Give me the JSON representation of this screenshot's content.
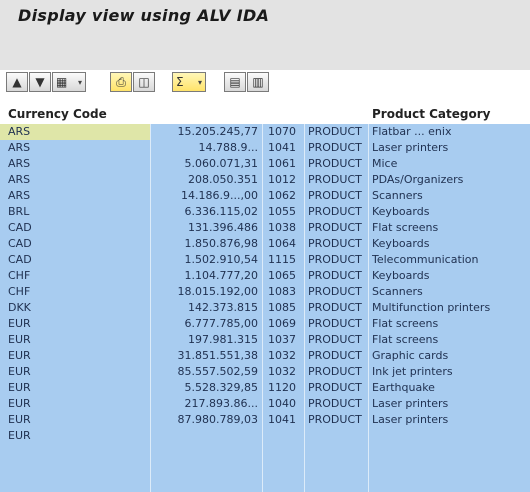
{
  "window": {
    "title": "Display view using ALV IDA"
  },
  "toolbar": {
    "groups": [
      {
        "buttons": [
          "sort-ascending-icon",
          "sort-descending-icon",
          "filter-icon"
        ]
      },
      {
        "buttons": [
          "print-icon",
          "export-icon"
        ]
      },
      {
        "buttons": [
          "sum-icon"
        ]
      },
      {
        "buttons": [
          "layout-icon",
          "details-icon"
        ]
      }
    ]
  },
  "columns": {
    "currency": "Currency Code",
    "category": "Product Category"
  },
  "rows": [
    {
      "currency": "ARS",
      "amount": "15.205.245,77",
      "num": "1070",
      "prod": "PRODUCT",
      "category": "Flatbar ... enix"
    },
    {
      "currency": "ARS",
      "amount": "14.788.9...",
      "num": "1041",
      "prod": "PRODUCT",
      "category": "Laser printers"
    },
    {
      "currency": "ARS",
      "amount": "5.060.071,31",
      "num": "1061",
      "prod": "PRODUCT",
      "category": "Mice"
    },
    {
      "currency": "ARS",
      "amount": "208.050.351",
      "num": "1012",
      "prod": "PRODUCT",
      "category": "PDAs/Organizers"
    },
    {
      "currency": "ARS",
      "amount": "14.186.9...,00",
      "num": "1062",
      "prod": "PRODUCT",
      "category": "Scanners"
    },
    {
      "currency": "BRL",
      "amount": "6.336.115,02",
      "num": "1055",
      "prod": "PRODUCT",
      "category": "Keyboards"
    },
    {
      "currency": "CAD",
      "amount": "131.396.486",
      "num": "1038",
      "prod": "PRODUCT",
      "category": "Flat screens"
    },
    {
      "currency": "CAD",
      "amount": "1.850.876,98",
      "num": "1064",
      "prod": "PRODUCT",
      "category": "Keyboards"
    },
    {
      "currency": "CAD",
      "amount": "1.502.910,54",
      "num": "1115",
      "prod": "PRODUCT",
      "category": "Telecommunication"
    },
    {
      "currency": "CHF",
      "amount": "1.104.777,20",
      "num": "1065",
      "prod": "PRODUCT",
      "category": "Keyboards"
    },
    {
      "currency": "CHF",
      "amount": "18.015.192,00",
      "num": "1083",
      "prod": "PRODUCT",
      "category": "Scanners"
    },
    {
      "currency": "DKK",
      "amount": "142.373.815",
      "num": "1085",
      "prod": "PRODUCT",
      "category": "Multifunction printers"
    },
    {
      "currency": "EUR",
      "amount": "6.777.785,00",
      "num": "1069",
      "prod": "PRODUCT",
      "category": "Flat screens"
    },
    {
      "currency": "EUR",
      "amount": "197.981.315",
      "num": "1037",
      "prod": "PRODUCT",
      "category": "Flat screens"
    },
    {
      "currency": "EUR",
      "amount": "31.851.551,38",
      "num": "1032",
      "prod": "PRODUCT",
      "category": "Graphic cards"
    },
    {
      "currency": "EUR",
      "amount": "85.557.502,59",
      "num": "1032",
      "prod": "PRODUCT",
      "category": "Ink jet printers"
    },
    {
      "currency": "EUR",
      "amount": "5.528.329,85",
      "num": "1120",
      "prod": "PRODUCT",
      "category": "Earthquake"
    },
    {
      "currency": "EUR",
      "amount": "217.893.86...",
      "num": "1040",
      "prod": "PRODUCT",
      "category": "Laser printers"
    },
    {
      "currency": "EUR",
      "amount": "87.980.789,03",
      "num": "1041",
      "prod": "PRODUCT",
      "category": "Laser printers"
    },
    {
      "currency": "EUR",
      "amount": "",
      "num": "",
      "prod": "",
      "category": ""
    }
  ]
}
